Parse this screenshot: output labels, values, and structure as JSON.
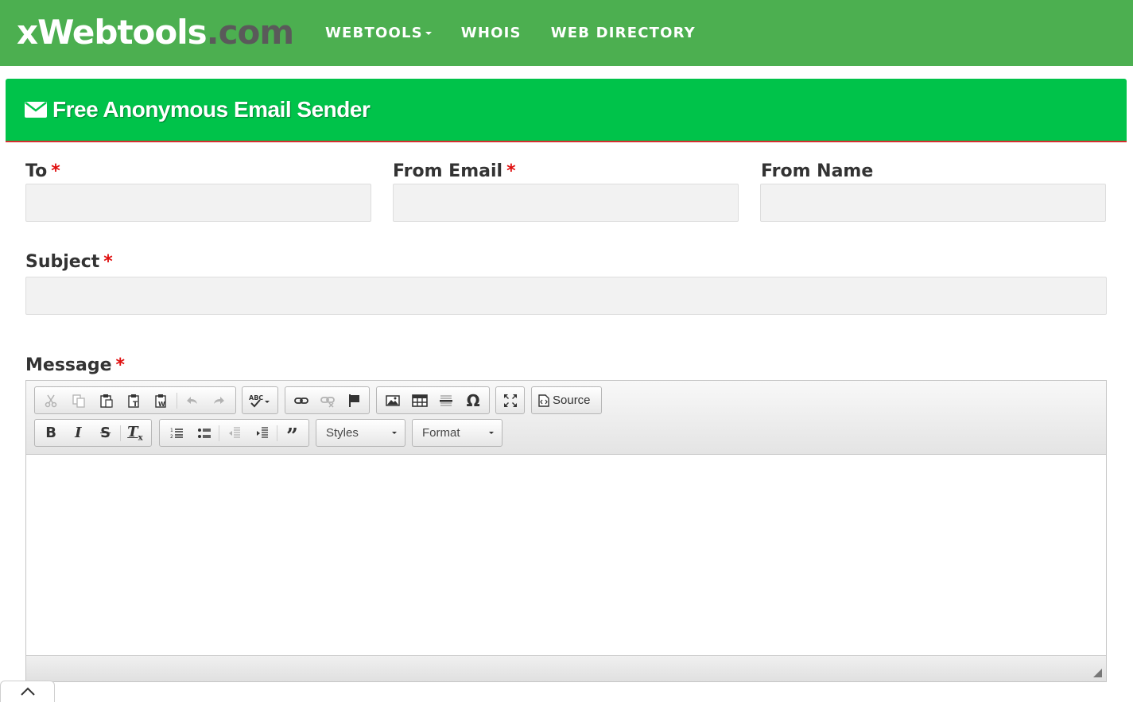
{
  "site": {
    "logo_main": "xWebtools",
    "logo_suffix": ".com"
  },
  "nav": {
    "items": [
      {
        "label": "WEBTOOLS",
        "has_dropdown": true
      },
      {
        "label": "WHOIS",
        "has_dropdown": false
      },
      {
        "label": "WEB DIRECTORY",
        "has_dropdown": false
      }
    ]
  },
  "panel": {
    "title": "Free Anonymous Email Sender",
    "icon": "envelope-icon"
  },
  "form": {
    "to": {
      "label": "To",
      "required_mark": "*",
      "value": ""
    },
    "from_email": {
      "label": "From Email",
      "required_mark": "*",
      "value": ""
    },
    "from_name": {
      "label": "From Name",
      "value": ""
    },
    "subject": {
      "label": "Subject",
      "required_mark": "*",
      "value": ""
    },
    "message": {
      "label": "Message",
      "required_mark": "*"
    }
  },
  "editor": {
    "source_label": "Source",
    "styles_label": "Styles",
    "format_label": "Format",
    "body": ""
  },
  "colors": {
    "navbar": "#4caf50",
    "panel_heading": "#00c34a",
    "heading_border": "#d32f2f",
    "required": "#e01010",
    "input_bg": "#f2f2f2"
  }
}
